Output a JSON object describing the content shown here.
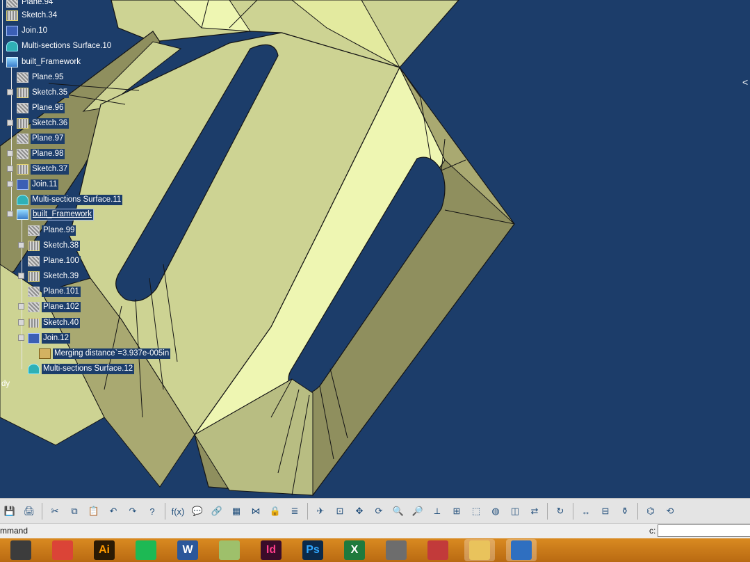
{
  "tree": {
    "items": [
      {
        "label": "Plane.94",
        "icon": "plane"
      },
      {
        "label": "Sketch.34",
        "icon": "sketch"
      },
      {
        "label": "Join.10",
        "icon": "join"
      },
      {
        "label": "Multi-sections Surface.10",
        "icon": "surf"
      },
      {
        "label": "built_Framework",
        "icon": "body"
      },
      {
        "label": "Plane.95",
        "icon": "plane"
      },
      {
        "label": "Sketch.35",
        "icon": "sketch"
      },
      {
        "label": "Plane.96",
        "icon": "plane"
      },
      {
        "label": "Sketch.36",
        "icon": "sketch"
      },
      {
        "label": "Plane.97",
        "icon": "plane"
      },
      {
        "label": "Plane.98",
        "icon": "plane"
      },
      {
        "label": "Sketch.37",
        "icon": "sketch"
      },
      {
        "label": "Join.11",
        "icon": "join"
      },
      {
        "label": "Multi-sections Surface.11",
        "icon": "surf"
      },
      {
        "label": "built_Framework",
        "icon": "body"
      },
      {
        "label": "Plane.99",
        "icon": "plane"
      },
      {
        "label": "Sketch.38",
        "icon": "sketch"
      },
      {
        "label": "Plane.100",
        "icon": "plane"
      },
      {
        "label": "Sketch.39",
        "icon": "sketch"
      },
      {
        "label": "Plane.101",
        "icon": "plane"
      },
      {
        "label": "Plane.102",
        "icon": "plane"
      },
      {
        "label": "Sketch.40",
        "icon": "sketch"
      },
      {
        "label": "Join.12",
        "icon": "join"
      },
      {
        "label": "Merging distance`=3.937e-005in",
        "icon": "param"
      },
      {
        "label": "Multi-sections Surface.12",
        "icon": "surf"
      },
      {
        "label": "dy",
        "icon": ""
      }
    ]
  },
  "viewport": {
    "background": "#1c3d6a",
    "model_colors": {
      "light": "#eef6b2",
      "mid": "#cdd393",
      "dark": "#8f8f5e",
      "edge": "#141414"
    }
  },
  "toolbar": {
    "buttons": [
      {
        "name": "save",
        "glyph": "💾"
      },
      {
        "name": "print",
        "glyph": "🖨"
      },
      {
        "name": "cut",
        "glyph": "✂"
      },
      {
        "name": "copy",
        "glyph": "⧉"
      },
      {
        "name": "paste",
        "glyph": "📋"
      },
      {
        "name": "undo",
        "glyph": "↶"
      },
      {
        "name": "redo",
        "glyph": "↷"
      },
      {
        "name": "whats-this",
        "glyph": "?"
      },
      {
        "name": "formula",
        "glyph": "f(x)"
      },
      {
        "name": "comment",
        "glyph": "💬"
      },
      {
        "name": "link",
        "glyph": "🔗"
      },
      {
        "name": "table",
        "glyph": "▦"
      },
      {
        "name": "graph",
        "glyph": "⋈"
      },
      {
        "name": "lock",
        "glyph": "🔒"
      },
      {
        "name": "parameters",
        "glyph": "≣"
      },
      {
        "name": "fly",
        "glyph": "✈"
      },
      {
        "name": "fit-all",
        "glyph": "⊡"
      },
      {
        "name": "pan",
        "glyph": "✥"
      },
      {
        "name": "rotate",
        "glyph": "⟳"
      },
      {
        "name": "zoom-in",
        "glyph": "🔍"
      },
      {
        "name": "zoom-out",
        "glyph": "🔎"
      },
      {
        "name": "normal-view",
        "glyph": "⟂"
      },
      {
        "name": "multi-view",
        "glyph": "⊞"
      },
      {
        "name": "iso-view",
        "glyph": "⬚"
      },
      {
        "name": "shading",
        "glyph": "◍"
      },
      {
        "name": "hide-show",
        "glyph": "◫"
      },
      {
        "name": "swap-visible",
        "glyph": "⇄"
      },
      {
        "name": "update",
        "glyph": "↻"
      },
      {
        "name": "measure",
        "glyph": "↔"
      },
      {
        "name": "measure-item",
        "glyph": "⊟"
      },
      {
        "name": "inertia",
        "glyph": "⚱"
      },
      {
        "name": "catalog",
        "glyph": "⌬"
      },
      {
        "name": "knowledge",
        "glyph": "⟲"
      }
    ]
  },
  "command_bar": {
    "label": "mmand",
    "input_label": "c:",
    "input_value": ""
  },
  "taskbar": {
    "apps": [
      {
        "name": "catia-start",
        "label": "",
        "color": "#3c3c3c"
      },
      {
        "name": "chrome",
        "label": "",
        "color": "#db4437"
      },
      {
        "name": "illustrator",
        "label": "Ai",
        "color": "#2b1a04"
      },
      {
        "name": "spotify",
        "label": "",
        "color": "#1db954"
      },
      {
        "name": "word",
        "label": "W",
        "color": "#2b579a"
      },
      {
        "name": "notepad",
        "label": "",
        "color": "#9ec06b"
      },
      {
        "name": "indesign",
        "label": "Id",
        "color": "#3a0c2a"
      },
      {
        "name": "photoshop",
        "label": "Ps",
        "color": "#0b2a4a"
      },
      {
        "name": "excel",
        "label": "X",
        "color": "#1f7a3d"
      },
      {
        "name": "app-10",
        "label": "",
        "color": "#6d6d6d"
      },
      {
        "name": "snipping",
        "label": "",
        "color": "#c23a3a"
      },
      {
        "name": "catia-1",
        "label": "",
        "color": "#e9c35c"
      },
      {
        "name": "catia-2",
        "label": "",
        "color": "#2f6fc0"
      }
    ]
  }
}
